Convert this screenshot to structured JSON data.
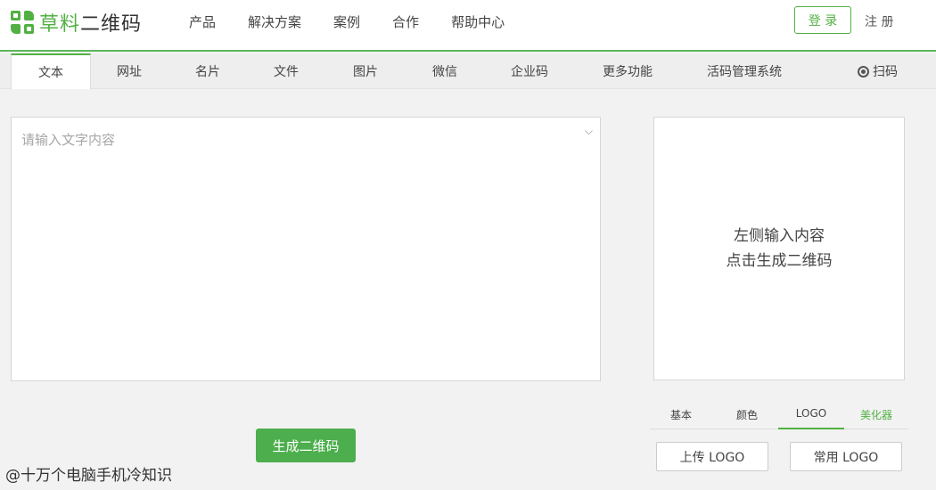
{
  "brand": {
    "name_green": "草料",
    "name_rest": "二维码"
  },
  "topnav": [
    "产品",
    "解决方案",
    "案例",
    "合作",
    "帮助中心"
  ],
  "account": {
    "login": "登 录",
    "register": "注 册"
  },
  "tabs": [
    "文本",
    "网址",
    "名片",
    "文件",
    "图片",
    "微信",
    "企业码",
    "更多功能",
    "活码管理系统"
  ],
  "active_tab": "文本",
  "scan_label": "扫码",
  "editor": {
    "placeholder": "请输入文字内容",
    "value": ""
  },
  "generate_label": "生成二维码",
  "preview": {
    "line1": "左侧输入内容",
    "line2": "点击生成二维码"
  },
  "style_tabs": [
    "基本",
    "颜色",
    "LOGO",
    "美化器"
  ],
  "active_style_tab": "LOGO",
  "logo_buttons": {
    "upload": "上传 LOGO",
    "common": "常用 LOGO"
  },
  "watermark": "@十万个电脑手机冷知识",
  "colors": {
    "accent": "#52b043",
    "button": "#4cae4c"
  }
}
